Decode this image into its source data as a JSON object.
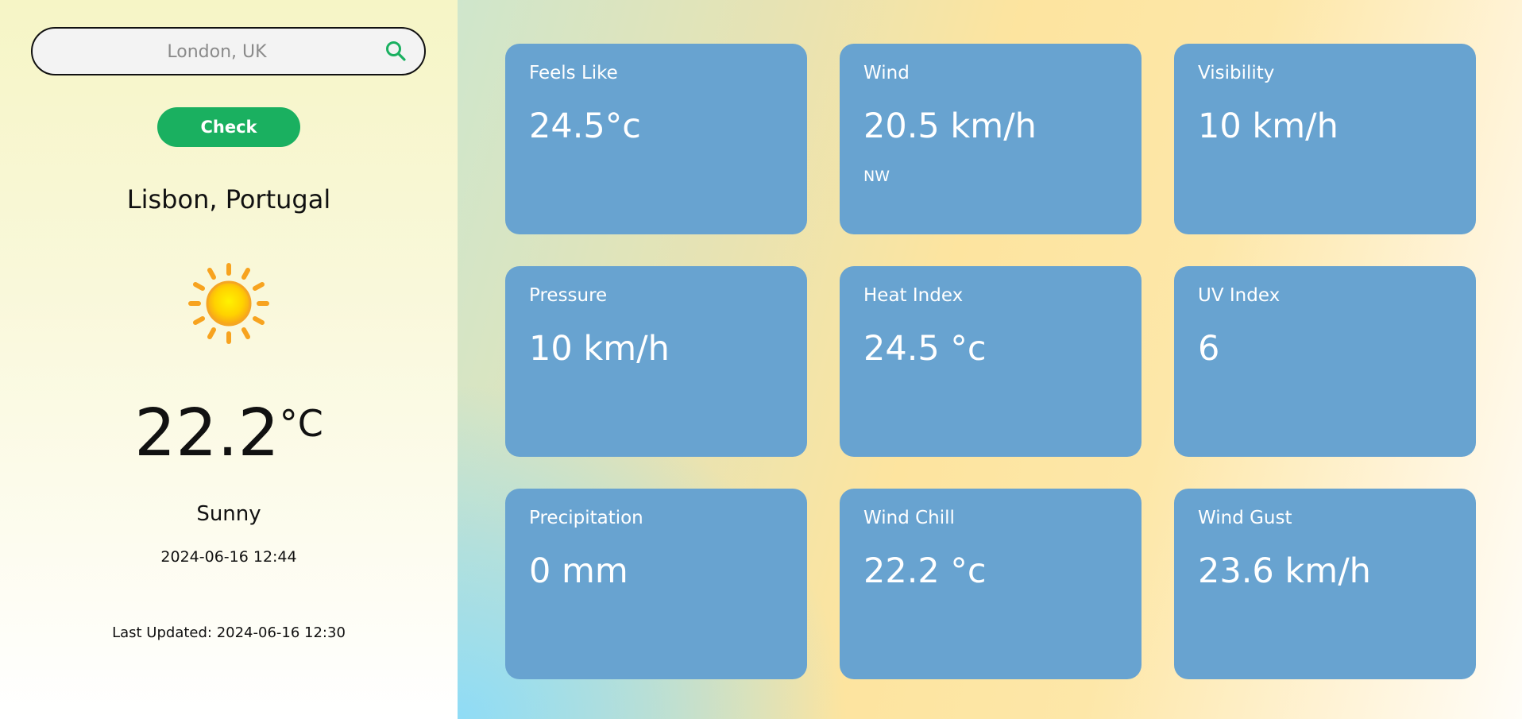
{
  "search": {
    "placeholder": "London, UK",
    "value": ""
  },
  "check_button": {
    "label": "Check",
    "color": "#1ab060"
  },
  "current": {
    "location": "Lisbon, Portugal",
    "icon": "sun-icon",
    "temperature": "22.2",
    "unit": "°C",
    "condition": "Sunny",
    "datetime": "2024-06-16 12:44",
    "last_updated": "Last Updated: 2024-06-16 12:30"
  },
  "cards": [
    {
      "label": "Feels Like",
      "value": "24.5°c",
      "sub": ""
    },
    {
      "label": "Wind",
      "value": "20.5 km/h",
      "sub": "NW"
    },
    {
      "label": "Visibility",
      "value": "10 km/h",
      "sub": ""
    },
    {
      "label": "Pressure",
      "value": "10 km/h",
      "sub": ""
    },
    {
      "label": "Heat Index",
      "value": "24.5 °c",
      "sub": ""
    },
    {
      "label": "UV Index",
      "value": "6",
      "sub": ""
    },
    {
      "label": "Precipitation",
      "value": "0 mm",
      "sub": ""
    },
    {
      "label": "Wind Chill",
      "value": "22.2 °c",
      "sub": ""
    },
    {
      "label": "Wind Gust",
      "value": "23.6 km/h",
      "sub": ""
    }
  ],
  "colors": {
    "card_bg": "#68a3d0",
    "accent": "#1ab060"
  }
}
